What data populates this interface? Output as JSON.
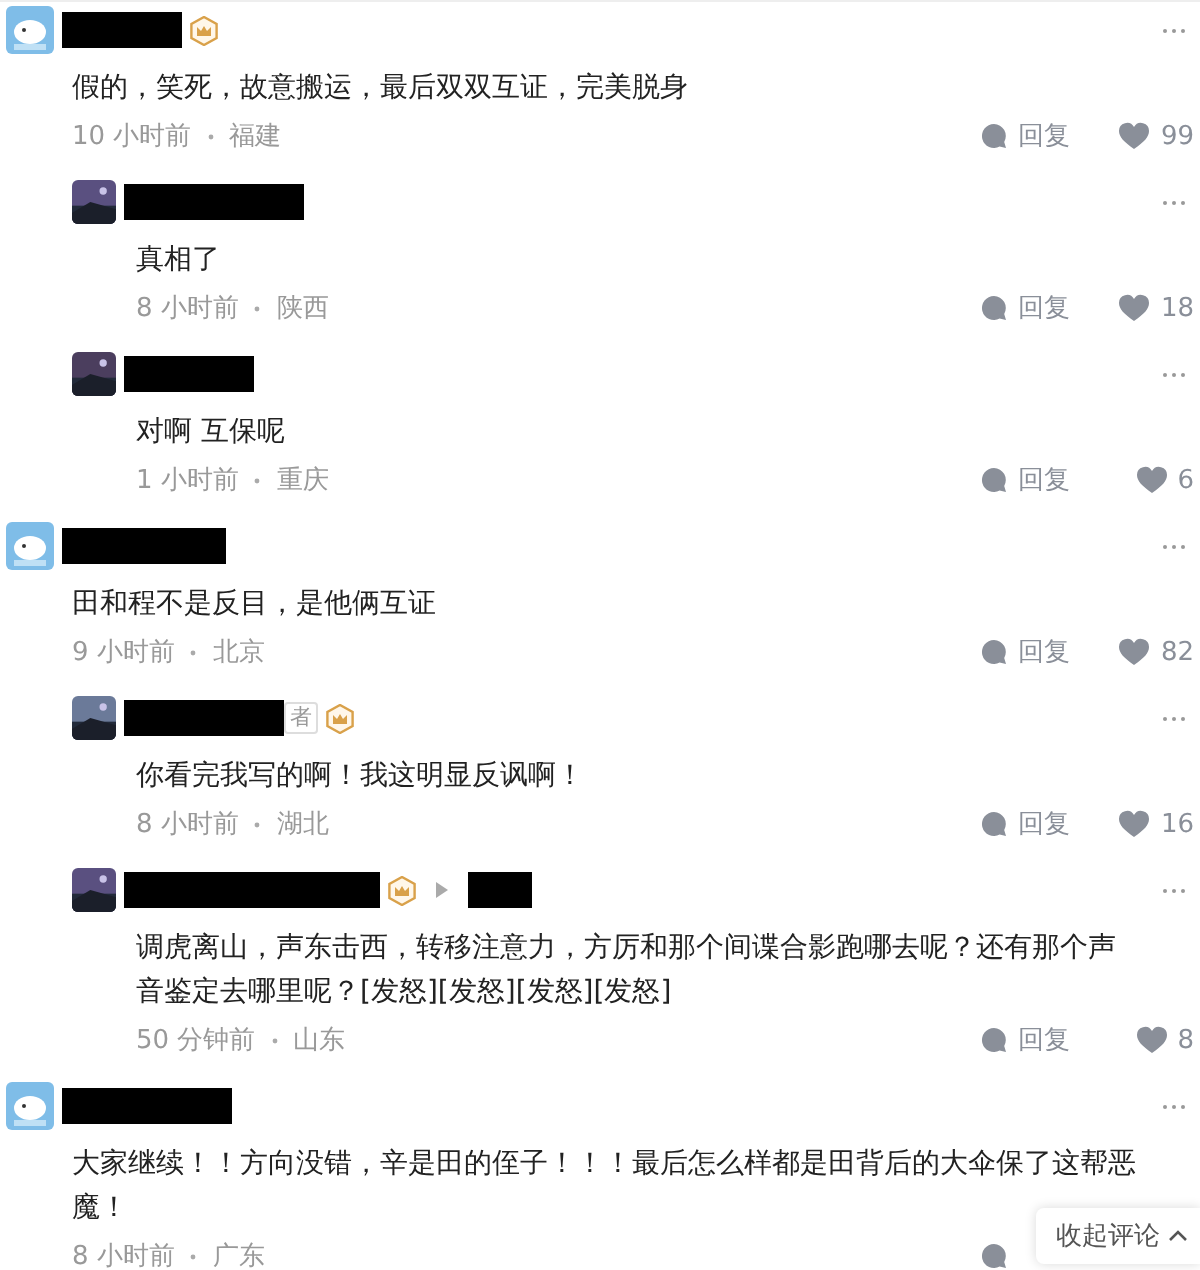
{
  "comments": [
    {
      "kind": "top",
      "crown": true,
      "reply_to": false,
      "text": "假的，笑死，故意搬运，最后双双互证，完美脱身",
      "time": "10 小时前",
      "location": "福建",
      "reply_label": "回复",
      "likes": "99"
    },
    {
      "kind": "reply",
      "crown": false,
      "reply_to": false,
      "text": "真相了",
      "time": "8 小时前",
      "location": "陕西",
      "reply_label": "回复",
      "likes": "18"
    },
    {
      "kind": "reply",
      "crown": false,
      "reply_to": false,
      "text": "对啊 互保呢",
      "time": "1 小时前",
      "location": "重庆",
      "reply_label": "回复",
      "likes": "6"
    },
    {
      "kind": "top",
      "crown": false,
      "reply_to": false,
      "text": "田和程不是反目，是他俩互证",
      "time": "9 小时前",
      "location": "北京",
      "reply_label": "回复",
      "likes": "82"
    },
    {
      "kind": "reply",
      "crown": true,
      "tag": "者",
      "reply_to": false,
      "text": "你看完我写的啊！我这明显反讽啊！",
      "time": "8 小时前",
      "location": "湖北",
      "reply_label": "回复",
      "likes": "16"
    },
    {
      "kind": "reply",
      "crown": true,
      "reply_to": true,
      "text": "调虎离山，声东击西，转移注意力，方厉和那个间谍合影跑哪去呢？还有那个声音鉴定去哪里呢？[发怒][发怒][发怒][发怒]",
      "time": "50 分钟前",
      "location": "山东",
      "reply_label": "回复",
      "likes": "8"
    },
    {
      "kind": "top",
      "crown": false,
      "reply_to": false,
      "text": "大家继续！！方向没错，辛是田的侄子！！！最后怎么样都是田背后的大伞保了这帮恶魔！",
      "time": "8 小时前",
      "location": "广东"
    }
  ],
  "collapse_button": {
    "label": "收起评论"
  }
}
